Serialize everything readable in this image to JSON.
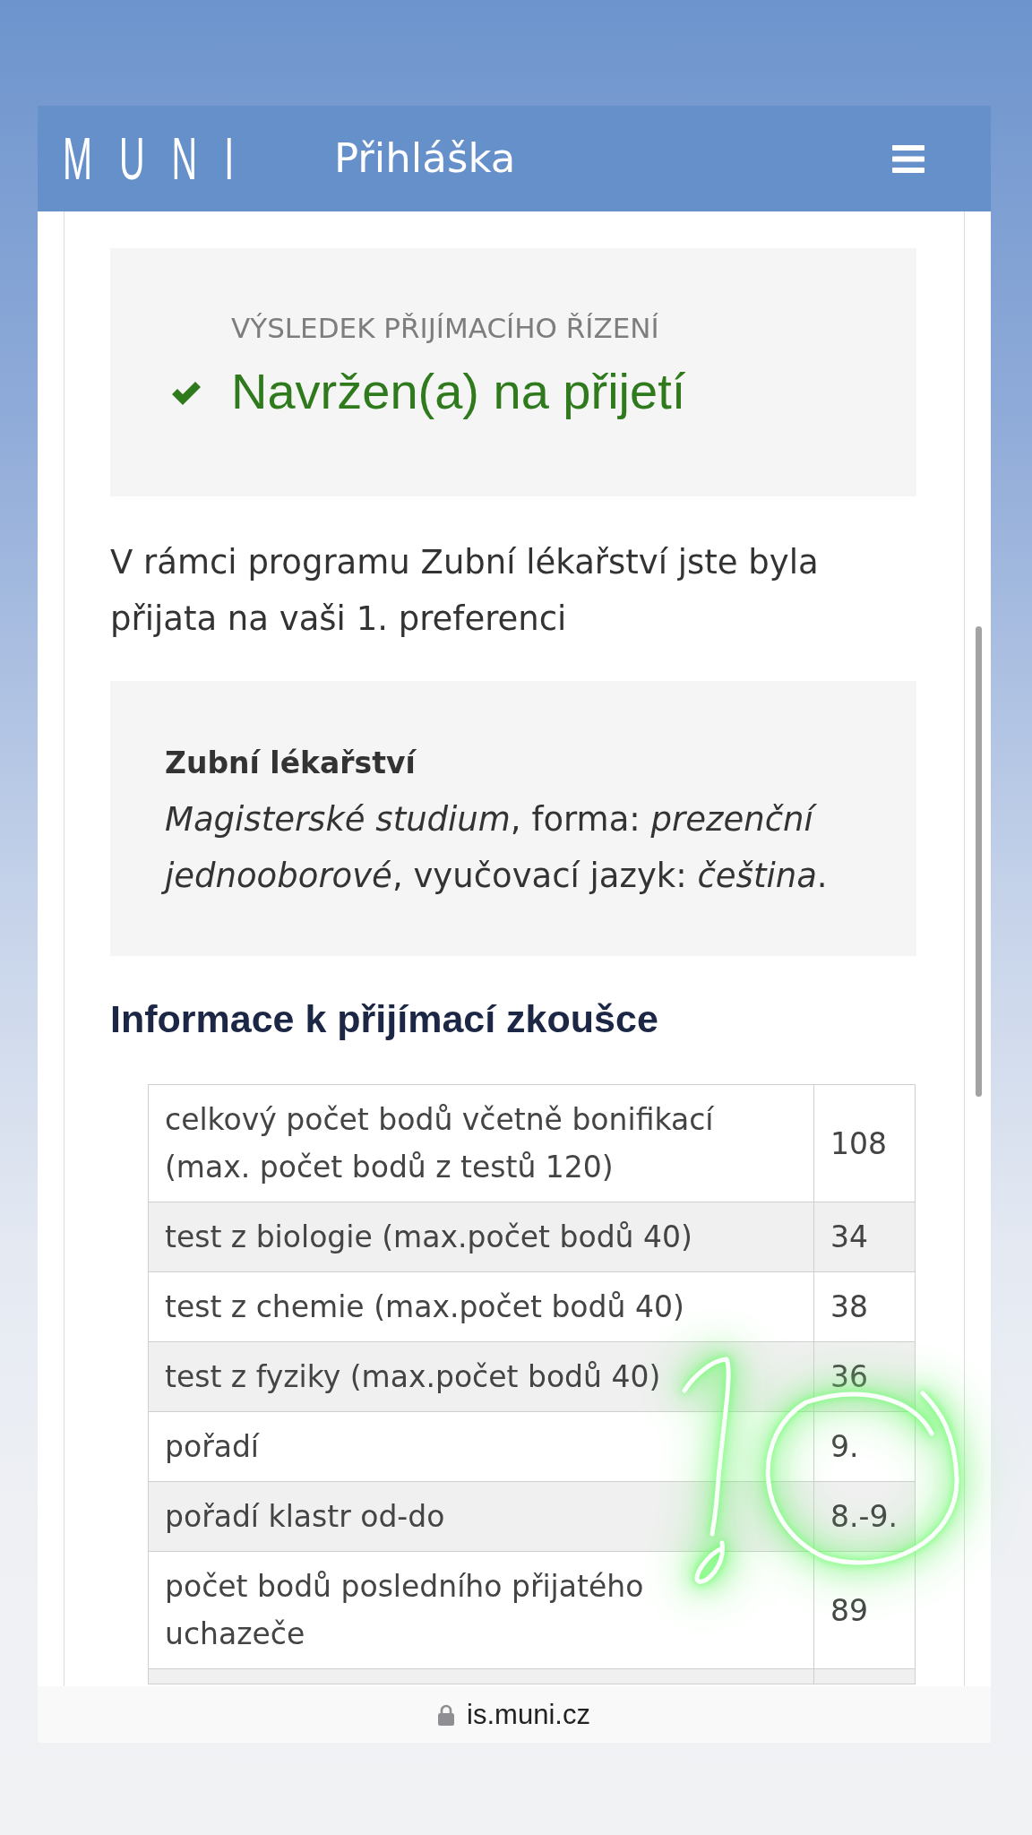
{
  "header": {
    "logo": "MUNI",
    "title": "Přihláška"
  },
  "result": {
    "label": "VÝSLEDEK PŘIJÍMACÍHO ŘÍZENÍ",
    "status": "Navržen(a) na přijetí",
    "accepted": true
  },
  "message": "V rámci programu Zubní lékařství jste byla přijata na vaši 1. preferenci",
  "programme": {
    "name": "Zubní lékařství",
    "details": "*Magisterské studium*, forma: *prezenční jednooborové*, vyučovací jazyk: *čeština*."
  },
  "exam_info": {
    "heading": "Informace k přijímací zkoušce",
    "rows": [
      {
        "label": "celkový počet bodů včetně bonifikací (max. počet bodů z testů 120)",
        "value": "108"
      },
      {
        "label": "test z biologie (max.počet bodů 40)",
        "value": "34"
      },
      {
        "label": "test z chemie (max.počet bodů 40)",
        "value": "38"
      },
      {
        "label": "test z fyziky (max.počet bodů 40)",
        "value": "36"
      },
      {
        "label": "pořadí",
        "value": "9."
      },
      {
        "label": "pořadí klastr od-do",
        "value": "8.-9."
      },
      {
        "label": "počet bodů posledního přijatého uchazeče",
        "value": "89"
      }
    ]
  },
  "address_bar": {
    "url": "is.muni.cz"
  }
}
